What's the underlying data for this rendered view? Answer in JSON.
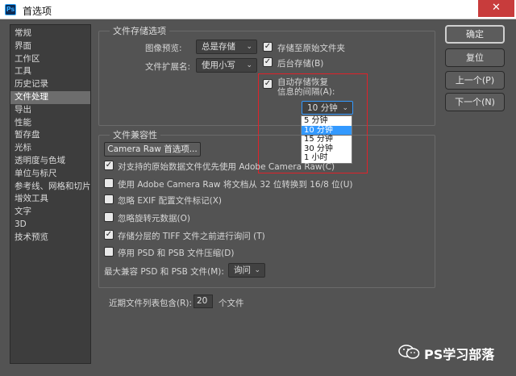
{
  "window": {
    "title": "首选项",
    "app_logo": "Ps",
    "close_icon": "✕"
  },
  "sidebar": {
    "items": [
      {
        "label": "常规"
      },
      {
        "label": "界面"
      },
      {
        "label": "工作区"
      },
      {
        "label": "工具"
      },
      {
        "label": "历史记录"
      },
      {
        "label": "文件处理",
        "selected": true
      },
      {
        "label": "导出"
      },
      {
        "label": "性能"
      },
      {
        "label": "暂存盘"
      },
      {
        "label": "光标"
      },
      {
        "label": "透明度与色域"
      },
      {
        "label": "单位与标尺"
      },
      {
        "label": "参考线、网格和切片"
      },
      {
        "label": "增效工具"
      },
      {
        "label": "文字"
      },
      {
        "label": "3D"
      },
      {
        "label": "技术预览"
      }
    ]
  },
  "file_saving": {
    "group_title": "文件存储选项",
    "image_preview_label": "图像预览:",
    "image_preview_value": "总是存储",
    "file_ext_label": "文件扩展名:",
    "file_ext_value": "使用小写",
    "save_to_original": {
      "label": "存储至原始文件夹",
      "checked": true
    },
    "background_save": {
      "label": "后台存储(B)",
      "checked": true
    },
    "auto_recovery": {
      "label_line1": "自动存储恢复",
      "label_line2": "信息的间隔(A):",
      "checked": true
    },
    "interval_value": "10 分钟",
    "interval_options": [
      "5 分钟",
      "10 分钟",
      "15 分钟",
      "30 分钟",
      "1 小时"
    ],
    "interval_highlight_index": 1
  },
  "compat": {
    "group_title": "文件兼容性",
    "camera_raw_button": "Camera Raw 首选项...",
    "options": [
      {
        "label": "对支持的原始数据文件优先使用 Adobe Camera Raw(C)",
        "checked": true
      },
      {
        "label": "使用 Adobe Camera Raw 将文档从 32 位转换到 16/8 位(U)",
        "checked": false
      },
      {
        "label": "忽略 EXIF 配置文件标记(X)",
        "checked": false
      },
      {
        "label": "忽略旋转元数据(O)",
        "checked": false
      },
      {
        "label": "存储分层的 TIFF 文件之前进行询问 (T)",
        "checked": true
      },
      {
        "label": "停用 PSD 和 PSB 文件压缩(D)",
        "checked": false
      }
    ],
    "max_compat_label": "最大兼容 PSD 和 PSB 文件(M):",
    "max_compat_value": "询问"
  },
  "recent": {
    "label": "近期文件列表包含(R):",
    "value": "20",
    "suffix": "个文件"
  },
  "buttons": {
    "ok": "确定",
    "reset": "复位",
    "prev": "上一个(P)",
    "next": "下一个(N)"
  },
  "watermark": {
    "text": "PS学习部落",
    "icon": "wechat-icon"
  },
  "colors": {
    "dialog_bg": "#535353",
    "highlight": "#3399ff",
    "annotation_red": "#e0222a",
    "close_red": "#c83c3c"
  }
}
